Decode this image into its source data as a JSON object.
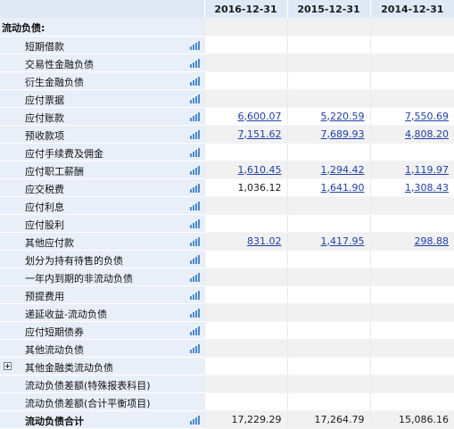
{
  "header": {
    "columns": [
      "2016-12-31",
      "2015-12-31",
      "2014-12-31"
    ]
  },
  "section_title": "流动负债:",
  "rows": [
    {
      "label": "短期借款",
      "values": [
        "",
        "",
        ""
      ]
    },
    {
      "label": "交易性金融负债",
      "values": [
        "",
        "",
        ""
      ]
    },
    {
      "label": "衍生金融负债",
      "values": [
        "",
        "",
        ""
      ]
    },
    {
      "label": "应付票据",
      "values": [
        "",
        "",
        ""
      ]
    },
    {
      "label": "应付账款",
      "values": [
        "6,600.07",
        "5,220.59",
        "7,550.69"
      ]
    },
    {
      "label": "预收款项",
      "values": [
        "7,151.62",
        "7,689.93",
        "4,808.20"
      ]
    },
    {
      "label": "应付手续费及佣金",
      "values": [
        "",
        "",
        ""
      ]
    },
    {
      "label": "应付职工薪酬",
      "values": [
        "1,610.45",
        "1,294.42",
        "1,119.97"
      ]
    },
    {
      "label": "应交税费",
      "values": [
        "1,036.12",
        "1,641.90",
        "1,308.43"
      ]
    },
    {
      "label": "应付利息",
      "values": [
        "",
        "",
        ""
      ]
    },
    {
      "label": "应付股利",
      "values": [
        "",
        "",
        ""
      ]
    },
    {
      "label": "其他应付款",
      "values": [
        "831.02",
        "1,417.95",
        "298.88"
      ]
    },
    {
      "label": "划分为持有待售的负债",
      "values": [
        "",
        "",
        ""
      ]
    },
    {
      "label": "一年内到期的非流动负债",
      "values": [
        "",
        "",
        ""
      ]
    },
    {
      "label": "预提费用",
      "values": [
        "",
        "",
        ""
      ]
    },
    {
      "label": "递延收益-流动负债",
      "values": [
        "",
        "",
        ""
      ]
    },
    {
      "label": "应付短期债券",
      "values": [
        "",
        "",
        ""
      ]
    },
    {
      "label": "其他流动负债",
      "values": [
        "",
        "",
        ""
      ]
    },
    {
      "label": "其他金融类流动负债",
      "values": [
        "",
        "",
        ""
      ]
    },
    {
      "label": "流动负债差额(特殊报表科目)",
      "values": [
        "",
        "",
        ""
      ]
    },
    {
      "label": "流动负债差额(合计平衡项目)",
      "values": [
        "",
        "",
        ""
      ]
    },
    {
      "label": "流动负债合计",
      "values": [
        "17,229.29",
        "17,264.79",
        "15,086.16"
      ]
    }
  ],
  "icons": {
    "bar_chart": "bar-chart-icon",
    "expand": "expand-plus-icon"
  },
  "colors": {
    "header_bg": "#dfe9f6",
    "label_bg": "#e9eff8",
    "link": "#1f3fa6",
    "icon_blue": "#4a8ad0"
  }
}
